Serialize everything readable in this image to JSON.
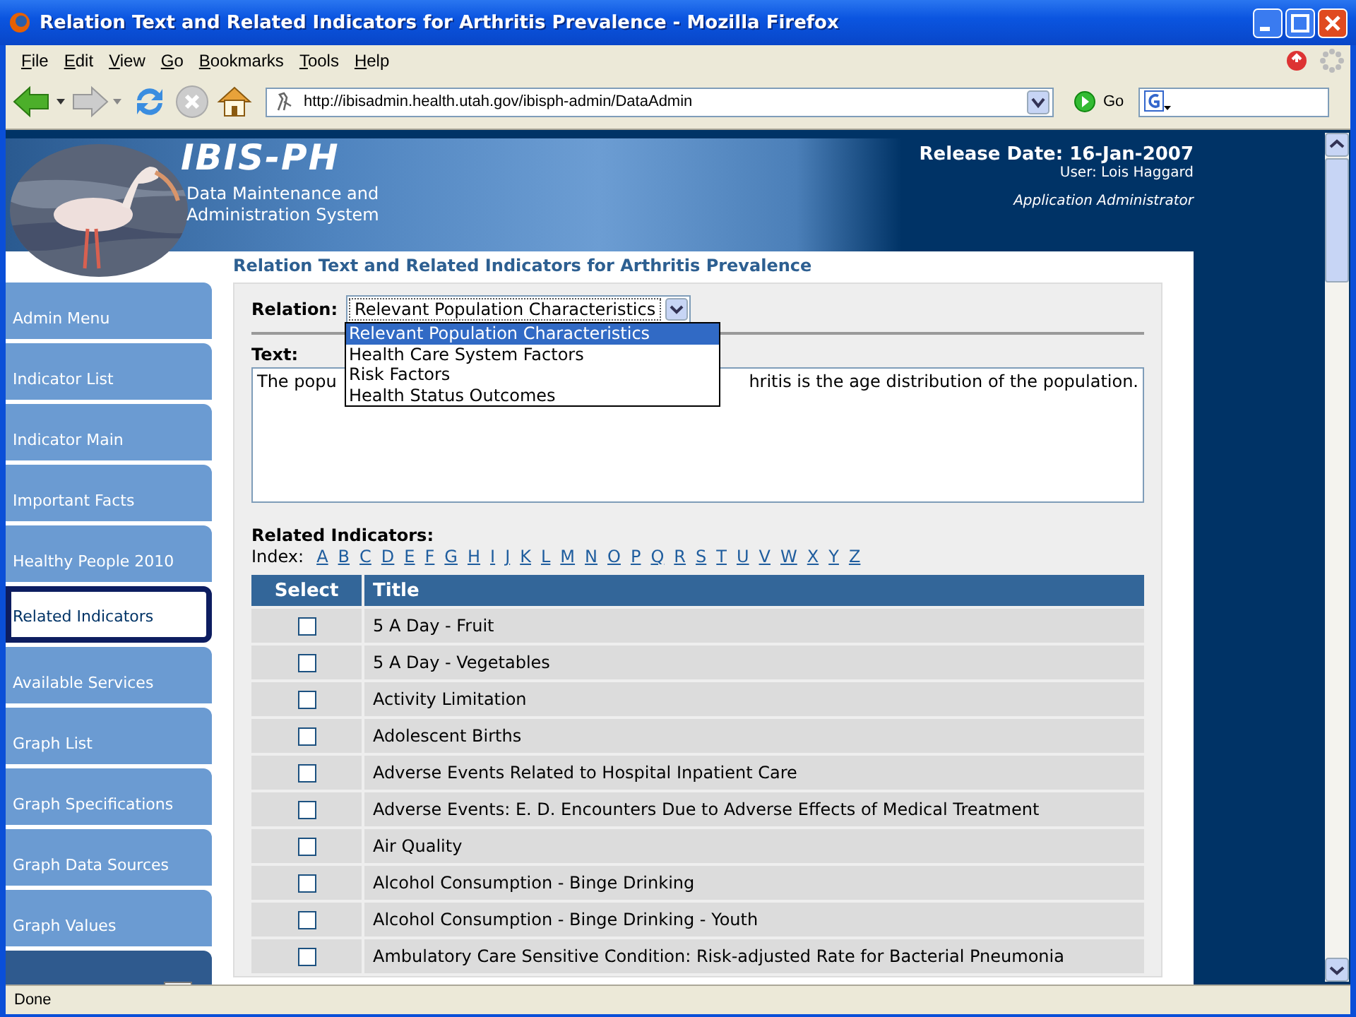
{
  "window": {
    "title": "Relation Text and Related Indicators for Arthritis Prevalence - Mozilla Firefox"
  },
  "menu": [
    "File",
    "Edit",
    "View",
    "Go",
    "Bookmarks",
    "Tools",
    "Help"
  ],
  "toolbar": {
    "url": "http://ibisadmin.health.utah.gov/ibisph-admin/DataAdmin",
    "go": "Go"
  },
  "header": {
    "logo": "IBIS-PH",
    "subtitle": [
      "Data Maintenance and",
      "Administration System"
    ],
    "release": "Release Date: 16-Jan-2007",
    "user": "User: Lois Haggard",
    "role": "Application Administrator"
  },
  "sidebar": {
    "items": [
      {
        "label": "Admin Menu",
        "selected": false
      },
      {
        "label": "Indicator List",
        "selected": false
      },
      {
        "label": "Indicator Main",
        "selected": false
      },
      {
        "label": "Important Facts",
        "selected": false
      },
      {
        "label": "Healthy People 2010",
        "selected": false
      },
      {
        "label": "Related Indicators",
        "selected": true
      },
      {
        "label": "Available Services",
        "selected": false
      },
      {
        "label": "Graph List",
        "selected": false
      },
      {
        "label": "Graph Specifications",
        "selected": false
      },
      {
        "label": "Graph Data Sources",
        "selected": false
      },
      {
        "label": "Graph Values",
        "selected": false
      }
    ]
  },
  "heading": "Relation Text and Related Indicators for Arthritis Prevalence",
  "relation": {
    "label": "Relation:",
    "value": "Relevant Population Characteristics",
    "expanded": true,
    "options": [
      {
        "label": "Relevant Population Characteristics",
        "selected": true
      },
      {
        "label": "Health Care System Factors",
        "selected": false
      },
      {
        "label": "Risk Factors",
        "selected": false
      },
      {
        "label": "Health Status Outcomes",
        "selected": false
      }
    ]
  },
  "text": {
    "label": "Text:",
    "visible_parts": [
      "The popu",
      "hritis is the age distribution of the population."
    ]
  },
  "related": {
    "label": "Related Indicators:",
    "index_label": "Index:",
    "letters": [
      "A",
      "B",
      "C",
      "D",
      "E",
      "F",
      "G",
      "H",
      "I",
      "J",
      "K",
      "L",
      "M",
      "N",
      "O",
      "P",
      "Q",
      "R",
      "S",
      "T",
      "U",
      "V",
      "W",
      "X",
      "Y",
      "Z"
    ]
  },
  "table": {
    "columns": [
      "Select",
      "Title"
    ],
    "rows": [
      {
        "checked": false,
        "title": "5 A Day - Fruit"
      },
      {
        "checked": false,
        "title": "5 A Day - Vegetables"
      },
      {
        "checked": false,
        "title": "Activity Limitation"
      },
      {
        "checked": false,
        "title": "Adolescent Births"
      },
      {
        "checked": false,
        "title": "Adverse Events Related to Hospital Inpatient Care"
      },
      {
        "checked": false,
        "title": "Adverse Events: E. D. Encounters Due to Adverse Effects of Medical Treatment"
      },
      {
        "checked": false,
        "title": "Air Quality"
      },
      {
        "checked": false,
        "title": "Alcohol Consumption - Binge Drinking"
      },
      {
        "checked": false,
        "title": "Alcohol Consumption - Binge Drinking - Youth"
      },
      {
        "checked": false,
        "title": "Ambulatory Care Sensitive Condition: Risk-adjusted Rate for Bacterial Pneumonia"
      }
    ]
  },
  "status_bar": "Done"
}
